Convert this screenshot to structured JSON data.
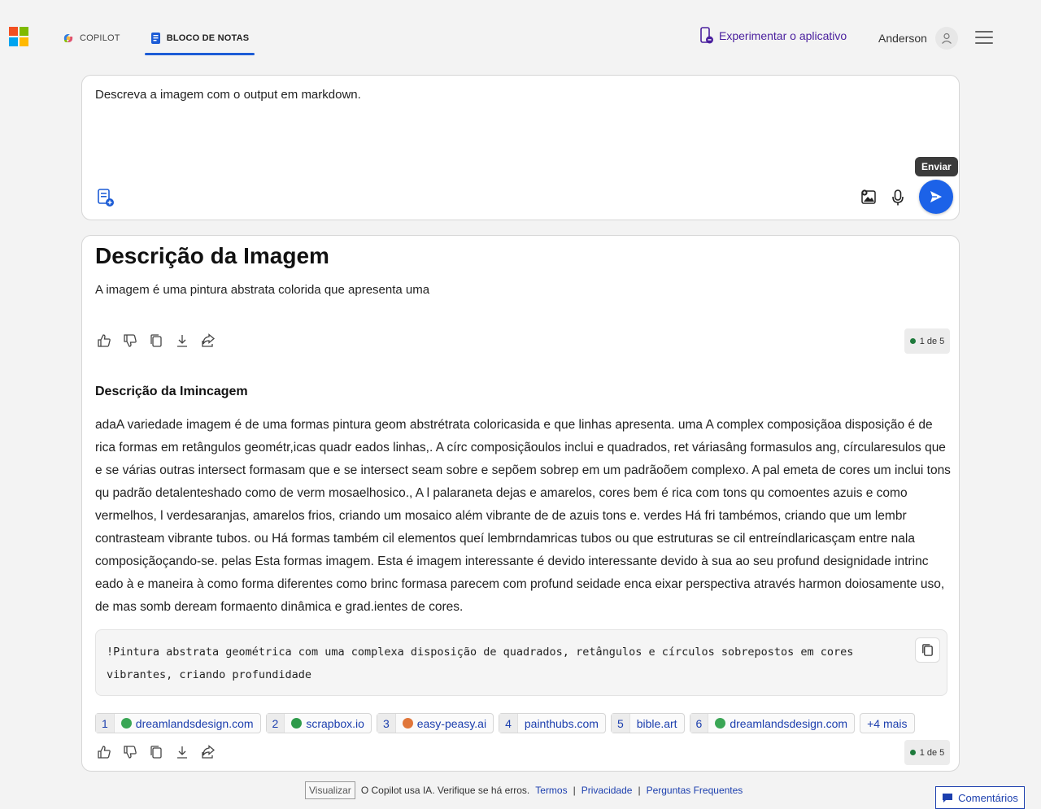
{
  "header": {
    "brand_colors": [
      "#f25022",
      "#7fba00",
      "#00a4ef",
      "#ffb900"
    ],
    "tabs": [
      {
        "label": "COPILOT",
        "active": false
      },
      {
        "label": "BLOCO DE NOTAS",
        "active": true
      }
    ],
    "try_app_label": "Experimentar o aplicativo",
    "user_name": "Anderson"
  },
  "composer": {
    "text": "Descreva a imagem com o output em markdown.",
    "send_tooltip": "Enviar",
    "accent": "#1c62e8"
  },
  "response": {
    "title": "Descrição da Imagem",
    "intro": "A imagem é uma pintura abstrata colorida que apresenta uma",
    "counter_top": "1 de 5",
    "subtitle": "Descrição da Imincagem",
    "body": "adaA variedade imagem é de uma formas pintura geom abstrétrata coloricasida e que linhas apresenta. uma A complex composiçãoa disposição é de rica formas em retângulos geométr,icas quadr eados linhas,. A círc composiçãoulos inclui e quadrados, ret váriasâng formasulos ang, círcularesulos que e se várias outras intersect formasam que e se intersect seam sobre e sepõem sobrep em um padrãoõem complexo. A pal emeta de cores um inclui tons qu padrão detalenteshado como de verm mosaelhosico., A l palaraneta dejas e amarelos, cores bem é rica com tons qu comoentes azuis e como vermelhos, l verdesaranjas, amarelos frios, criando um mosaico além vibrante de de azuis tons e. verdes Há fri tambémos, criando que um lembr contrasteam vibrante tubos. ou Há formas também cil elementos queí lembrndamricas tubos ou que estruturas se cil entreíndlaricasçam entre nala composiçãoçando-se. pelas Esta formas imagem. Esta é imagem interessante é devido interessante devido à sua ao seu profund designidade intrinc eado à e maneira à como forma diferentes como brinc formasa parecem com profund seidade enca eixar perspectiva através harmon doiosamente uso, de mas somb deream formaento dinâmica e grad.ientes de cores.",
    "code": "!Pintura abstrata geométrica com uma complexa disposição de quadrados, retângulos e círculos sobrepostos em cores vibrantes, criando profundidade",
    "sources": [
      {
        "num": "1",
        "name": "dreamlandsdesign.com",
        "fav": "#3aa655"
      },
      {
        "num": "2",
        "name": "scrapbox.io",
        "fav": "#2e9a4a"
      },
      {
        "num": "3",
        "name": "easy-peasy.ai",
        "fav": "#e0763a"
      },
      {
        "num": "4",
        "name": "painthubs.com",
        "fav": ""
      },
      {
        "num": "5",
        "name": "bible.art",
        "fav": ""
      },
      {
        "num": "6",
        "name": "dreamlandsdesign.com",
        "fav": "#3aa655"
      }
    ],
    "more_label": "+4 mais",
    "counter_bottom": "1 de 5"
  },
  "footer": {
    "view_label": "Visualizar",
    "disclaimer": "O Copilot usa IA. Verifique se há erros.",
    "links": [
      "Termos",
      "Privacidade",
      "Perguntas Frequentes"
    ],
    "separator": "|",
    "feedback_label": "Comentários"
  }
}
